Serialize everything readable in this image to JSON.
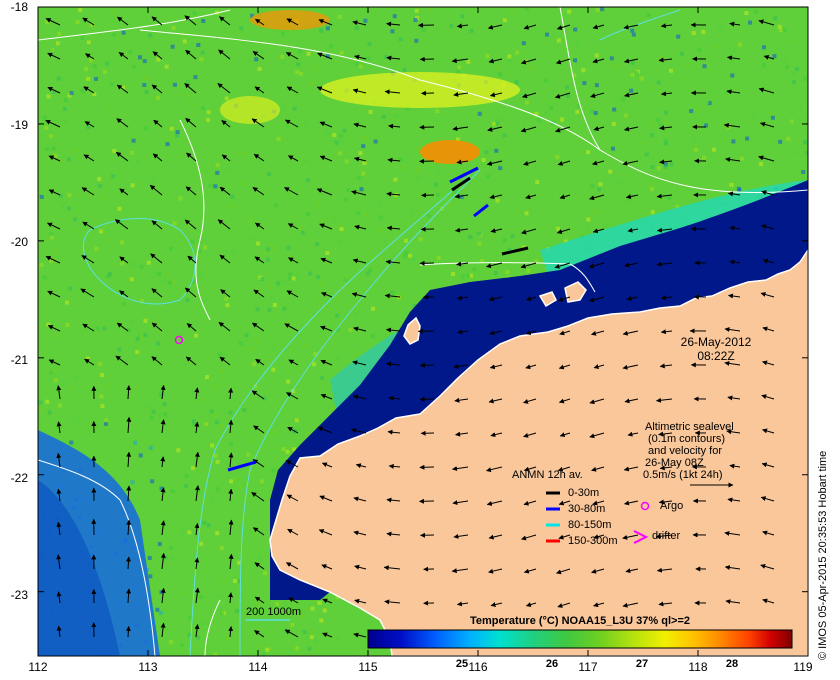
{
  "map": {
    "x_ticks": [
      "112",
      "113",
      "114",
      "115",
      "116",
      "117",
      "118",
      "119"
    ],
    "y_ticks": [
      "-18",
      "-19",
      "-20",
      "-21",
      "-22",
      "-23"
    ],
    "x_range": [
      112,
      119
    ],
    "y_range": [
      -23.55,
      -18
    ],
    "land_color": "#f9c79a",
    "ocean_base_color": "#5fcf3a",
    "cold_water_color": "#00188a"
  },
  "annotations": {
    "date": "26-May-2012",
    "time": "08:22Z",
    "altimetry_lines": [
      "Altimetric sealevel",
      "(0.1m contours)",
      "and velocity for",
      "26-May 08Z",
      "0.5m/s (1kt 24h)"
    ],
    "scale_bar_label": "200  1000m",
    "credit": "© IMOS 05-Apr-2015 20:35:53 Hobart time"
  },
  "legend": {
    "title": "ANMN 12h av.",
    "items": [
      {
        "label": "0-30m",
        "color": "#000000"
      },
      {
        "label": "30-80m",
        "color": "#0000ff"
      },
      {
        "label": "80-150m",
        "color": "#00e5e5"
      },
      {
        "label": "150-300m",
        "color": "#ff0000"
      }
    ],
    "argo_label": "Argo",
    "argo_color": "#ff00ff",
    "drifter_label": "drifter",
    "drifter_color": "#ff00ff"
  },
  "colorbar": {
    "title": "Temperature (°C) NOAA15_L3U 37% ql>=2",
    "ticks": [
      "25",
      "26",
      "27",
      "28"
    ],
    "min": 24.0,
    "max": 28.7,
    "colors": [
      "#00008f",
      "#0010c8",
      "#0060ff",
      "#00b0ff",
      "#00e0d0",
      "#20d080",
      "#40c840",
      "#70d020",
      "#b0e010",
      "#f0f000",
      "#ffc000",
      "#ff8000",
      "#ff4000",
      "#d00000",
      "#800000"
    ]
  }
}
